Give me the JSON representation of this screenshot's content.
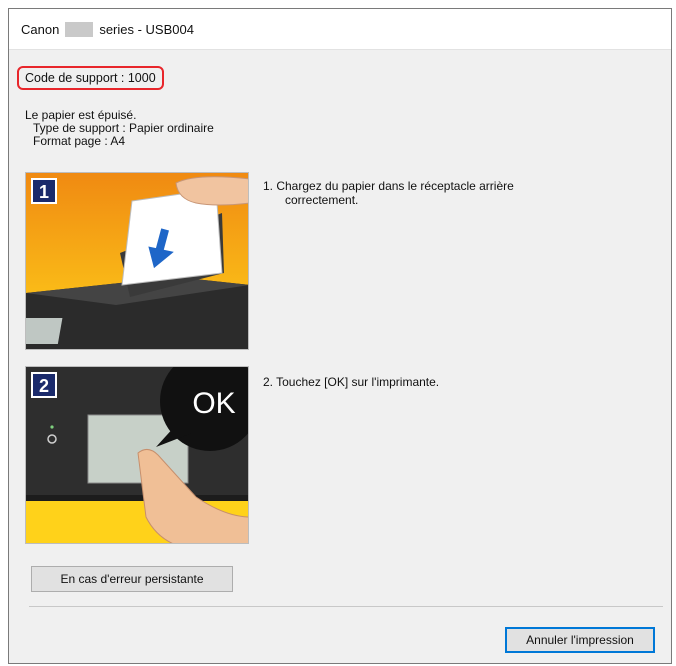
{
  "window": {
    "title_prefix": "Canon",
    "title_suffix": "series - USB004"
  },
  "support_code": "Code de support : 1000",
  "message": {
    "line1": "Le papier est épuisé.",
    "line2": "Type de support : Papier ordinaire",
    "line3": "Format page : A4"
  },
  "steps": [
    {
      "badge": "1",
      "text_line1": "1.  Chargez du papier dans le réceptacle arrière",
      "text_line2": "correctement."
    },
    {
      "badge": "2",
      "text_line1": "2.  Touchez [OK] sur l'imprimante.",
      "ok_label": "OK"
    }
  ],
  "buttons": {
    "persistent_error": "En cas d'erreur persistante",
    "cancel_print": "Annuler l'impression"
  },
  "colors": {
    "highlight": "#e8262b",
    "step_badge": "#1a2a6b",
    "accent": "#0078d7"
  }
}
